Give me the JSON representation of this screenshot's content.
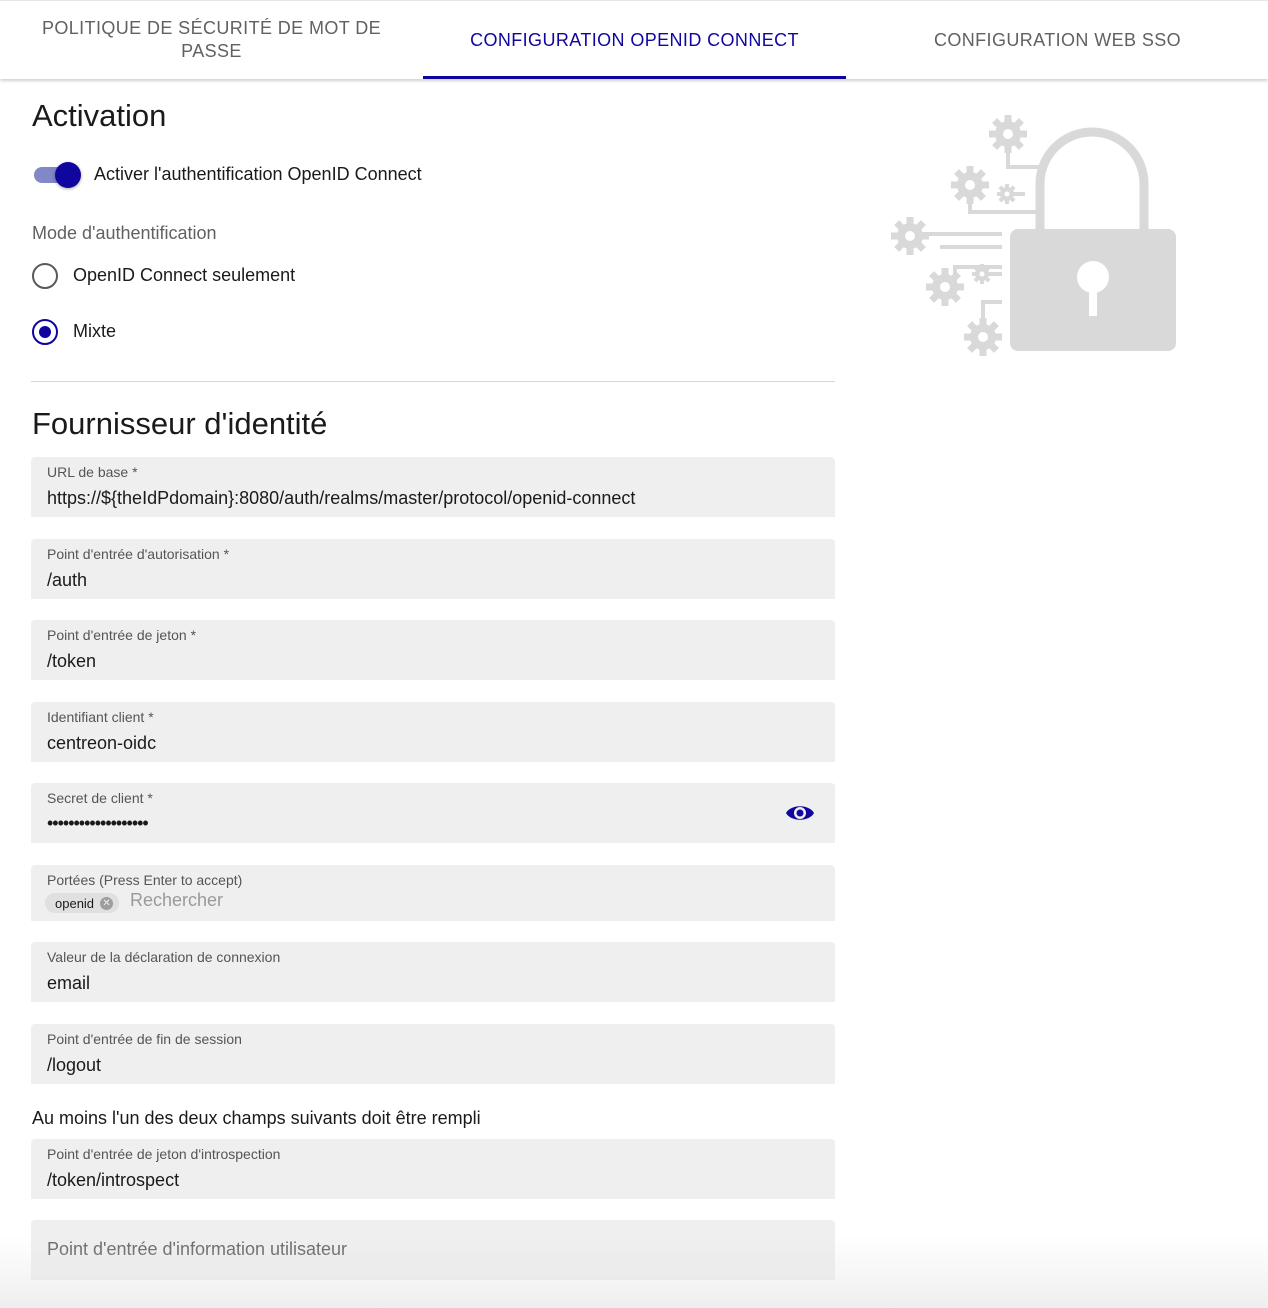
{
  "tabs": [
    {
      "label": "POLITIQUE DE SÉCURITÉ DE MOT DE PASSE"
    },
    {
      "label": "CONFIGURATION OPENID CONNECT"
    },
    {
      "label": "CONFIGURATION WEB SSO"
    }
  ],
  "active_tab_index": 1,
  "activation": {
    "title": "Activation",
    "toggle_label": "Activer l'authentification OpenID Connect",
    "toggle_on": true,
    "mode_label": "Mode d'authentification",
    "options": [
      {
        "label": "OpenID Connect seulement",
        "selected": false
      },
      {
        "label": "Mixte",
        "selected": true
      }
    ]
  },
  "provider": {
    "title": "Fournisseur d'identité",
    "fields": {
      "base_url": {
        "label": "URL de base",
        "required": "*",
        "value": "https://${theIdPdomain}:8080/auth/realms/master/protocol/openid-connect"
      },
      "auth_endpoint": {
        "label": "Point d'entrée d'autorisation",
        "required": "*",
        "value": "/auth"
      },
      "token_endpoint": {
        "label": "Point d'entrée de jeton",
        "required": "*",
        "value": "/token"
      },
      "client_id": {
        "label": "Identifiant client",
        "required": "*",
        "value": "centreon-oidc"
      },
      "client_secret": {
        "label": "Secret de client",
        "required": "*",
        "value": "•••••••••••••••••••"
      },
      "scopes": {
        "label": "Portées (Press Enter to accept)",
        "chip": "openid",
        "placeholder": "Rechercher"
      },
      "login_claim": {
        "label": "Valeur de la déclaration de connexion",
        "value": "email"
      },
      "logout_endpoint": {
        "label": "Point d'entrée de fin de session",
        "value": "/logout"
      },
      "introspection_endpoint": {
        "label": "Point d'entrée de jeton d'introspection",
        "value": "/token/introspect"
      },
      "userinfo_endpoint": {
        "placeholder": "Point d'entrée d'information utilisateur"
      }
    },
    "hint": "Au moins l'un des deux champs suivants doit être rempli"
  },
  "colors": {
    "accent": "#10069f",
    "field_bg": "#efefef",
    "illustration": "#d9d9d9"
  },
  "icons": {
    "secret_visibility": "eye-icon",
    "chip_delete": "cancel-circle-icon",
    "illustration": "lock-gears-icon"
  }
}
